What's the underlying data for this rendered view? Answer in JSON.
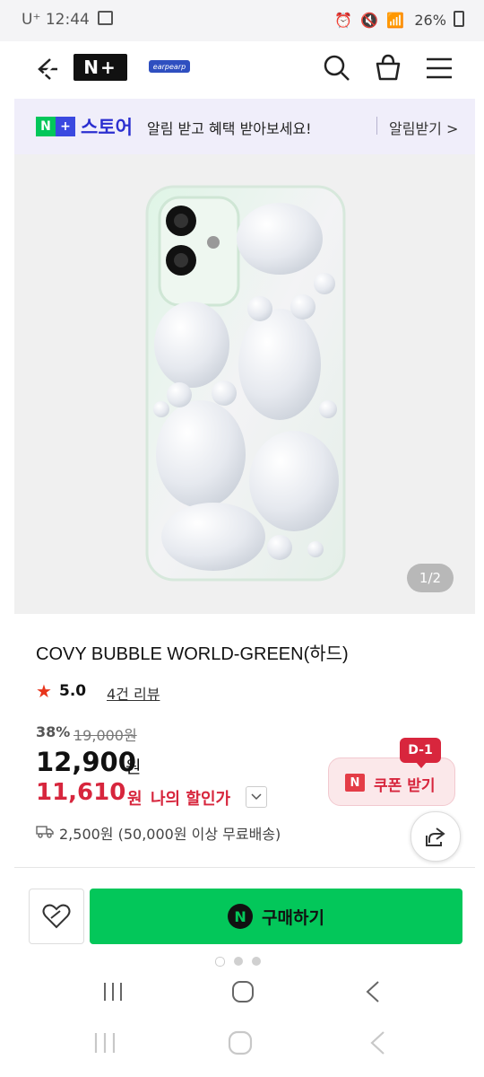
{
  "status": {
    "carrier": "U⁺",
    "time": "12:44",
    "battery": "26%"
  },
  "header": {
    "store_logo": "N+",
    "brand_logo": "earpearp",
    "icons": [
      "back-icon",
      "close-icon",
      "search-icon",
      "cart-icon",
      "menu-icon"
    ]
  },
  "banner": {
    "badge_n": "N",
    "badge_plus": "+",
    "store_name": "스토어",
    "message": "알림 받고 혜택 받아보세요!",
    "link": "알림받기 >"
  },
  "gallery": {
    "page": "1/2"
  },
  "product": {
    "title": "COVY BUBBLE WORLD-GREEN(하드)",
    "rating": "5.0",
    "review_link": "4건 리뷰",
    "discount_pct": "38%",
    "original_price": "19,000원",
    "price": "12,900",
    "price_unit": "원",
    "my_price": "11,610",
    "my_price_unit": "원",
    "my_price_label": "나의 할인가"
  },
  "coupon": {
    "dday": "D-1",
    "badge": "N",
    "label": "쿠폰 받기"
  },
  "shipping": {
    "text": "2,500원 (50,000원 이상 무료배송)"
  },
  "actions": {
    "buy_badge": "N",
    "buy_label": "구매하기"
  },
  "colors": {
    "buy_green": "#03c75a",
    "accent_red": "#d7263d",
    "store_blue": "#2b2fd0"
  }
}
